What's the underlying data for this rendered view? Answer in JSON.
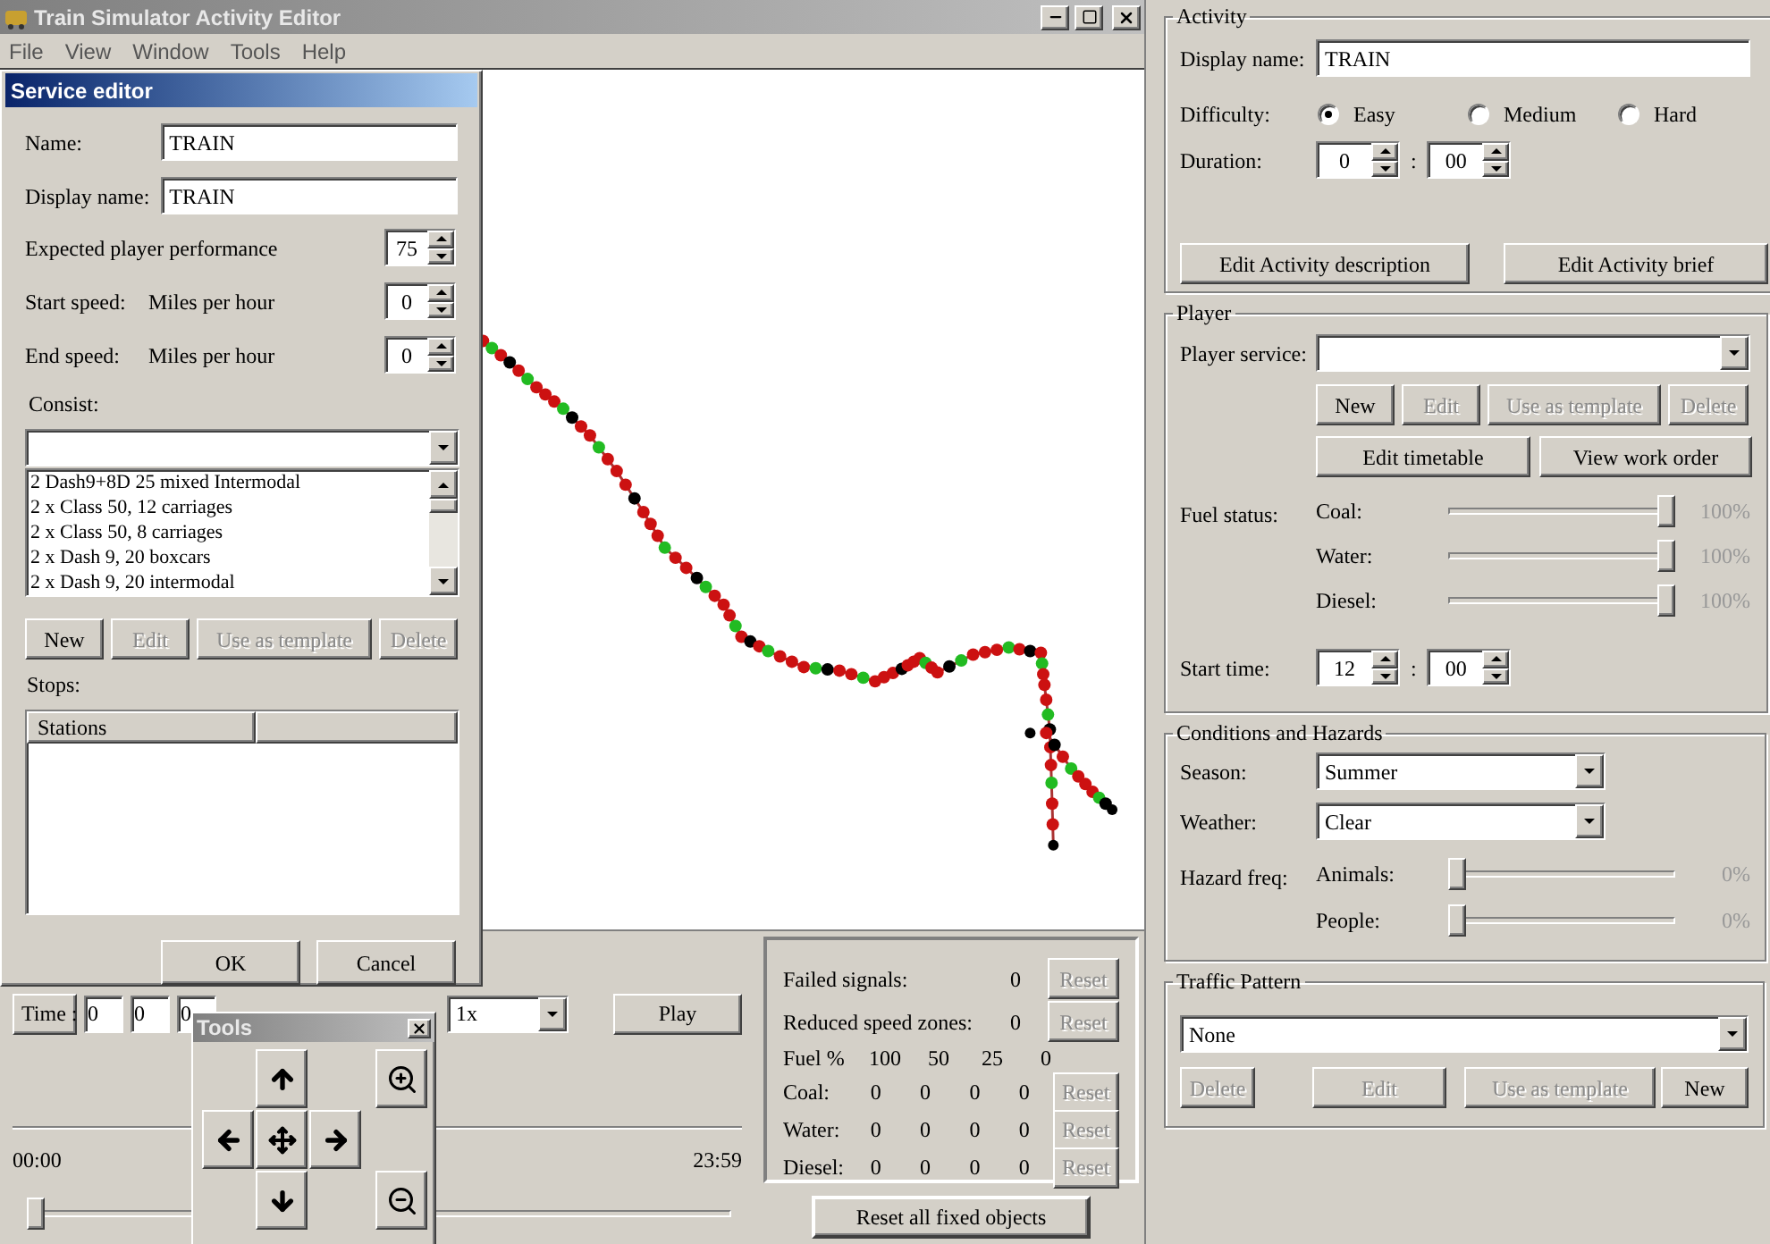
{
  "window": {
    "title": "Train Simulator Activity Editor"
  },
  "menu": [
    "File",
    "View",
    "Window",
    "Tools",
    "Help"
  ],
  "service_editor": {
    "title": "Service editor",
    "name_label": "Name:",
    "name": "TRAIN",
    "display_name_label": "Display name:",
    "display_name": "TRAIN",
    "performance_label": "Expected player performance",
    "performance": "75",
    "speeds": [
      {
        "label": "Start speed:",
        "unit": "Miles per hour",
        "value": "0"
      },
      {
        "label": "End speed:",
        "unit": "Miles per hour",
        "value": "0"
      }
    ],
    "consist_label": "Consist:",
    "consists": [
      "2 Dash9+8D 25 mixed Intermodal",
      "2 x Class 50, 12 carriages",
      "2 x Class 50, 8 carriages",
      "2 x Dash 9, 20 boxcars",
      "2 x Dash 9, 20 intermodal"
    ],
    "consist_buttons": [
      {
        "label": "New",
        "disabled": false
      },
      {
        "label": "Edit",
        "disabled": true
      },
      {
        "label": "Use as template",
        "disabled": true
      },
      {
        "label": "Delete",
        "disabled": true
      }
    ],
    "stops_label": "Stops:",
    "stops_column": "Stations",
    "buttons": [
      "OK",
      "Cancel"
    ]
  },
  "playback": {
    "time_button": "Time :",
    "time_fields": [
      "0",
      "0",
      "0"
    ],
    "speed": "1x",
    "play": "Play",
    "start": "00:00",
    "end": "23:59",
    "level": 0
  },
  "counters": {
    "rows": [
      {
        "label": "Failed signals:",
        "value": "0",
        "reset": "Reset",
        "disabled": true
      },
      {
        "label": "Reduced speed zones:",
        "value": "0",
        "reset": "Reset",
        "disabled": true
      }
    ],
    "fuel_header": [
      "Fuel %",
      "100",
      "50",
      "25",
      "0"
    ],
    "fuel_rows": [
      {
        "label": "Coal:",
        "values": [
          "0",
          "0",
          "0",
          "0"
        ],
        "reset": "Reset",
        "disabled": true
      },
      {
        "label": "Water:",
        "values": [
          "0",
          "0",
          "0",
          "0"
        ],
        "reset": "Reset",
        "disabled": true
      },
      {
        "label": "Diesel:",
        "values": [
          "0",
          "0",
          "0",
          "0"
        ],
        "reset": "Reset",
        "disabled": true
      }
    ],
    "reset_all": "Reset all fixed objects"
  },
  "tools": {
    "title": "Tools"
  },
  "activity": {
    "title": "Activity",
    "display_name_label": "Display name:",
    "display_name": "TRAIN",
    "difficulty_label": "Difficulty:",
    "difficulties": [
      {
        "label": "Easy",
        "selected": true
      },
      {
        "label": "Medium",
        "selected": false
      },
      {
        "label": "Hard",
        "selected": false
      }
    ],
    "duration_label": "Duration:",
    "duration": {
      "hours": "0",
      "sep": ":",
      "minutes": "00"
    },
    "buttons": [
      "Edit Activity description",
      "Edit Activity brief"
    ]
  },
  "player": {
    "title": "Player",
    "service_label": "Player service:",
    "service_buttons": [
      {
        "label": "New",
        "disabled": false
      },
      {
        "label": "Edit",
        "disabled": true
      },
      {
        "label": "Use as template",
        "disabled": true
      },
      {
        "label": "Delete",
        "disabled": true
      }
    ],
    "buttons": [
      "Edit timetable",
      "View work order"
    ],
    "fuel_label": "Fuel status:",
    "fuel": [
      {
        "label": "Coal:",
        "level": 1,
        "reading": "100%"
      },
      {
        "label": "Water:",
        "level": 1,
        "reading": "100%"
      },
      {
        "label": "Diesel:",
        "level": 1,
        "reading": "100%"
      }
    ],
    "start_time_label": "Start time:",
    "start_time": {
      "hours": "12",
      "sep": ":",
      "minutes": "00"
    }
  },
  "conditions": {
    "title": "Conditions and Hazards",
    "season_label": "Season:",
    "season": "Summer",
    "weather_label": "Weather:",
    "weather": "Clear",
    "hazard_label": "Hazard freq:",
    "hazards": [
      {
        "label": "Animals:",
        "level": 0,
        "reading": "0%"
      },
      {
        "label": "People:",
        "level": 0,
        "reading": "0%"
      }
    ]
  },
  "traffic": {
    "title": "Traffic Pattern",
    "pattern": "None",
    "buttons": [
      {
        "label": "Delete",
        "disabled": true
      },
      {
        "label": "Edit",
        "disabled": true
      },
      {
        "label": "Use as template",
        "disabled": true
      },
      {
        "label": "New",
        "disabled": false
      }
    ]
  }
}
